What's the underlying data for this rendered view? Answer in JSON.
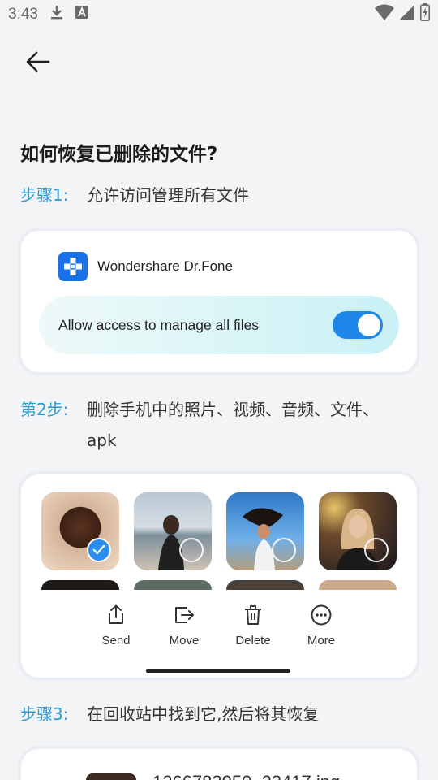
{
  "status_bar": {
    "time": "3:43",
    "left_icons": [
      "download-icon",
      "app-store-a-icon"
    ],
    "right_icons": [
      "wifi-icon",
      "cellular-signal-icon",
      "battery-charging-icon"
    ]
  },
  "header": {
    "back_icon": "arrow-left-icon"
  },
  "page": {
    "title": "如何恢复已删除的文件?"
  },
  "step1": {
    "label": "步骤1:",
    "text": "允许访问管理所有文件"
  },
  "permission_card": {
    "app_name": "Wondershare Dr.Fone",
    "allow_text": "Allow access to manage all files",
    "toggle_on": true,
    "accent_color": "#1e86e8"
  },
  "step2": {
    "label": "第2步:",
    "text": "删除手机中的照片、视频、音频、文件、apk"
  },
  "gallery_card": {
    "photos": [
      {
        "name": "photo-1",
        "selected": true
      },
      {
        "name": "photo-2",
        "selected": false
      },
      {
        "name": "photo-3",
        "selected": false
      },
      {
        "name": "photo-4",
        "selected": false
      }
    ],
    "actions": {
      "send": "Send",
      "move": "Move",
      "delete": "Delete",
      "more": "More"
    }
  },
  "step3": {
    "label": "步骤3:",
    "text": "在回收站中找到它,然后将其恢复"
  },
  "recycle_card": {
    "partial_text": "1266783950_23417.jpg"
  }
}
